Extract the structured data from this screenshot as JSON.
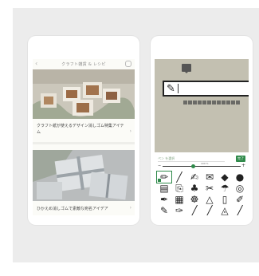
{
  "colors": {
    "panel_bg": "#ececec",
    "accent": "#2f8a4a",
    "beige": "#c3c0b1"
  },
  "phone_left": {
    "topbar": {
      "back_icon": "chevron-left-icon",
      "title": "クラフト雑貨 & レシピ",
      "share_icon": "share-icon"
    },
    "articles": [
      {
        "photo": "craft-boxes-photo",
        "caption": "クラフト紙が使えるデザイン消しゴム特集アイテム",
        "chevron": "chevron-right-icon"
      },
      {
        "photo": "gift-wrapping-photo",
        "caption": "ひかえめ消しゴムで素敵な宛名アイデア",
        "chevron": "chevron-right-icon"
      }
    ]
  },
  "phone_right": {
    "message_icon": "speech-bubble-icon",
    "stamp": {
      "pen_icon": "pencil-icon",
      "text": ""
    },
    "page_dots": 12,
    "search": {
      "placeholder": "ペン を選択",
      "button_label": "完了"
    },
    "zoom_label": "100 %",
    "tools": [
      "✏",
      "╱",
      "✍",
      "✉",
      "◆",
      "●",
      "▤",
      "⎘",
      "♣",
      "✂",
      "☂",
      "◎",
      "✒",
      "▦",
      "☸",
      "△",
      "▯",
      "✐",
      "✎",
      "✑",
      "╱",
      "╱",
      "◬",
      "╱"
    ]
  }
}
